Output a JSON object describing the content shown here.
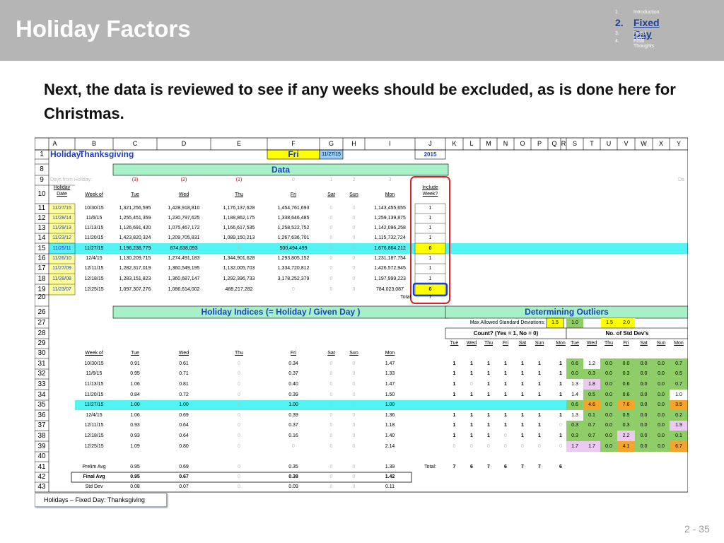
{
  "header": {
    "title": "Holiday Factors",
    "nav": [
      {
        "num": "1.",
        "label": "Introduction",
        "active": false
      },
      {
        "num": "2.",
        "label": "Fixed Day",
        "active": true
      },
      {
        "num": "3.",
        "label": "Fixed Date",
        "active": false
      },
      {
        "num": "4.",
        "label": "Final Thoughts",
        "active": false
      }
    ]
  },
  "subtitle": "Next, the data is reviewed to see if any weeks should be excluded, as is done here for Christmas.",
  "sheet": {
    "col_letters": [
      "A",
      "B",
      "C",
      "D",
      "E",
      "F",
      "G",
      "H",
      "I",
      "J",
      "K",
      "L",
      "M",
      "N",
      "O",
      "P",
      "Q",
      "R",
      "S",
      "T",
      "U",
      "V",
      "W",
      "X",
      "Y"
    ],
    "row1": {
      "rownum": "1",
      "holiday_label": "Holiday:",
      "holiday": "Thanksgiving",
      "day": "Fri",
      "date": "11/27/15",
      "year": "2015"
    },
    "row8": {
      "rownum": "8",
      "data_label": "Data"
    },
    "row9": {
      "rownum": "9",
      "label": "Days from Holiday:",
      "values": [
        "(3)",
        "(2)",
        "(1)",
        "0",
        "1",
        "2",
        "3"
      ],
      "trail": "Da"
    },
    "row10": {
      "rownum": "10",
      "holiday_date": "Holiday Date",
      "week_of": "Week of",
      "days": [
        "Tue",
        "Wed",
        "Thu",
        "Fri",
        "Sat",
        "Sun",
        "Mon"
      ],
      "include": "Include Week?"
    },
    "data_rows": [
      {
        "rownum": "11",
        "date": "11/27/15",
        "week": "10/30/15",
        "tue": "1,321,256,595",
        "wed": "1,428,918,810",
        "thu": "1,176,137,628",
        "fri": "1,454,761,693",
        "sat": "0",
        "sun": "0",
        "mon": "1,143,455,655",
        "inc": "1",
        "hl": false
      },
      {
        "rownum": "12",
        "date": "11/28/14",
        "week": "11/6/15",
        "tue": "1,255,451,359",
        "wed": "1,230,797,625",
        "thu": "1,188,862,175",
        "fri": "1,338,646,485",
        "sat": "0",
        "sun": "0",
        "mon": "1,259,139,875",
        "inc": "1",
        "hl": false
      },
      {
        "rownum": "13",
        "date": "11/29/13",
        "week": "11/13/15",
        "tue": "1,126,691,420",
        "wed": "1,075,467,172",
        "thu": "1,166,617,535",
        "fri": "1,258,522,752",
        "sat": "0",
        "sun": "0",
        "mon": "1,142,096,258",
        "inc": "1",
        "hl": false
      },
      {
        "rownum": "14",
        "date": "11/23/12",
        "week": "11/20/15",
        "tue": "1,423,820,324",
        "wed": "1,209,705,831",
        "thu": "1,089,150,213",
        "fri": "1,267,636,701",
        "sat": "0",
        "sun": "0",
        "mon": "1,115,732,724",
        "inc": "1",
        "hl": false
      },
      {
        "rownum": "15",
        "date": "11/25/11",
        "week": "11/27/15",
        "tue": "1,196,238,779",
        "wed": "874,638,093",
        "thu": "0",
        "fri": "500,494,499",
        "sat": "0",
        "sun": "0",
        "mon": "1,676,864,212",
        "inc": "0",
        "hl": true
      },
      {
        "rownum": "16",
        "date": "11/26/10",
        "week": "12/4/15",
        "tue": "1,130,209,715",
        "wed": "1,274,491,183",
        "thu": "1,344,901,628",
        "fri": "1,293,805,152",
        "sat": "0",
        "sun": "0",
        "mon": "1,231,187,754",
        "inc": "1",
        "hl": false
      },
      {
        "rownum": "17",
        "date": "11/27/09",
        "week": "12/11/15",
        "tue": "1,282,317,019",
        "wed": "1,360,549,195",
        "thu": "1,132,005,703",
        "fri": "1,334,720,812",
        "sat": "0",
        "sun": "0",
        "mon": "1,426,572,945",
        "inc": "1",
        "hl": false
      },
      {
        "rownum": "18",
        "date": "11/28/08",
        "week": "12/18/15",
        "tue": "1,283,151,823",
        "wed": "1,360,687,147",
        "thu": "1,292,396,733",
        "fri": "3,178,252,379",
        "sat": "0",
        "sun": "0",
        "mon": "1,197,999,223",
        "inc": "1",
        "hl": false
      },
      {
        "rownum": "19",
        "date": "11/23/07",
        "week": "12/25/15",
        "tue": "1,097,307,276",
        "wed": "1,086,614,002",
        "thu": "488,217,282",
        "fri": "0",
        "sat": "0",
        "sun": "0",
        "mon": "784,023,087",
        "inc": "0",
        "hl": false
      }
    ],
    "row20": {
      "rownum": "20",
      "total_label": "Total:",
      "total": "7"
    },
    "row26": {
      "rownum": "26",
      "indices_label": "Holiday Indices  (= Holiday / Given Day )",
      "outliers_label": "Determining Outliers"
    },
    "row27": {
      "rownum": "27",
      "max_label": "Max Allowed Standard Deviations:",
      "v1": "1.5",
      "v2": "1.0",
      "v3": "1.5",
      "v4": "2.0"
    },
    "row28": {
      "rownum": "28",
      "count_label": "Count?  (Yes = 1, No = 0)",
      "std_label": "No. of Std Dev's"
    },
    "row29": {
      "rownum": "29",
      "days_a": [
        "Tue",
        "Wed",
        "Thu",
        "Fri",
        "Sat",
        "Sun",
        "Mon"
      ],
      "days_b": [
        "Tue",
        "Wed",
        "Thu",
        "Fri",
        "Sat",
        "Sun",
        "Mon"
      ]
    },
    "row30": {
      "rownum": "30",
      "week_of": "Week of",
      "days": [
        "Tue",
        "Wed",
        "Thu",
        "Fri",
        "Sat",
        "Sun",
        "Mon"
      ]
    },
    "index_rows": [
      {
        "rownum": "31",
        "week": "10/30/15",
        "tue": "0.91",
        "wed": "0.61",
        "thu": "0",
        "fri": "0.34",
        "sat": "0",
        "sun": "0",
        "mon": "1.47",
        "cnt": [
          "1",
          "1",
          "1",
          "1",
          "1",
          "1",
          "1"
        ],
        "sd": [
          "0.6",
          "1.2",
          "0.0",
          "0.0",
          "0.0",
          "0.0",
          "0.7"
        ],
        "hl": false
      },
      {
        "rownum": "32",
        "week": "11/6/15",
        "tue": "0.95",
        "wed": "0.71",
        "thu": "0",
        "fri": "0.37",
        "sat": "0",
        "sun": "0",
        "mon": "1.33",
        "cnt": [
          "1",
          "1",
          "1",
          "1",
          "1",
          "1",
          "1"
        ],
        "sd": [
          "0.0",
          "0.3",
          "0.0",
          "0.3",
          "0.0",
          "0.0",
          "0.5"
        ],
        "hl": false
      },
      {
        "rownum": "33",
        "week": "11/13/15",
        "tue": "1.06",
        "wed": "0.81",
        "thu": "0",
        "fri": "0.40",
        "sat": "0",
        "sun": "0",
        "mon": "1.47",
        "cnt": [
          "1",
          "0",
          "1",
          "1",
          "1",
          "1",
          "1"
        ],
        "sd": [
          "1.3",
          "1.8",
          "0.0",
          "0.6",
          "0.0",
          "0.0",
          "0.7"
        ],
        "hl": false
      },
      {
        "rownum": "34",
        "week": "11/20/15",
        "tue": "0.84",
        "wed": "0.72",
        "thu": "0",
        "fri": "0.39",
        "sat": "0",
        "sun": "0",
        "mon": "1.50",
        "cnt": [
          "1",
          "1",
          "1",
          "1",
          "1",
          "1",
          "1"
        ],
        "sd": [
          "1.4",
          "0.5",
          "0.0",
          "0.6",
          "0.0",
          "0.0",
          "1.0"
        ],
        "hl": false
      },
      {
        "rownum": "35",
        "week": "11/27/15",
        "tue": "1.00",
        "wed": "1.00",
        "thu": "0",
        "fri": "1.00",
        "sat": "0",
        "sun": "0",
        "mon": "1.00",
        "cnt": [
          "",
          "",
          "",
          "",
          "",
          "",
          ""
        ],
        "sd": [
          "0.6",
          "4.6",
          "0.0",
          "7.6",
          "0.0",
          "0.0",
          "3.5"
        ],
        "hl": true
      },
      {
        "rownum": "36",
        "week": "12/4/15",
        "tue": "1.06",
        "wed": "0.69",
        "thu": "0",
        "fri": "0.39",
        "sat": "0",
        "sun": "0",
        "mon": "1.36",
        "cnt": [
          "1",
          "1",
          "1",
          "1",
          "1",
          "1",
          "1"
        ],
        "sd": [
          "1.3",
          "0.1",
          "0.0",
          "0.5",
          "0.0",
          "0.0",
          "0.2"
        ],
        "hl": false
      },
      {
        "rownum": "37",
        "week": "12/11/15",
        "tue": "0.93",
        "wed": "0.64",
        "thu": "0",
        "fri": "0.37",
        "sat": "0",
        "sun": "0",
        "mon": "1.18",
        "cnt": [
          "1",
          "1",
          "1",
          "1",
          "1",
          "1",
          "0"
        ],
        "sd": [
          "0.3",
          "0.7",
          "0.0",
          "0.3",
          "0.0",
          "0.0",
          "1.9"
        ],
        "hl": false
      },
      {
        "rownum": "38",
        "week": "12/18/15",
        "tue": "0.93",
        "wed": "0.64",
        "thu": "0",
        "fri": "0.16",
        "sat": "0",
        "sun": "0",
        "mon": "1.40",
        "cnt": [
          "1",
          "1",
          "1",
          "0",
          "1",
          "1",
          "1"
        ],
        "sd": [
          "0.3",
          "0.7",
          "0.0",
          "2.2",
          "0.0",
          "0.0",
          "0.1"
        ],
        "hl": false
      },
      {
        "rownum": "39",
        "week": "12/25/15",
        "tue": "1.09",
        "wed": "0.80",
        "thu": "0",
        "fri": "0",
        "sat": "0",
        "sun": "0",
        "mon": "2.14",
        "cnt": [
          "0",
          "0",
          "0",
          "0",
          "0",
          "0",
          "0"
        ],
        "sd": [
          "1.7",
          "1.7",
          "0.0",
          "4.1",
          "0.0",
          "0.0",
          "6.7"
        ],
        "hl": false
      }
    ],
    "row40": {
      "rownum": "40"
    },
    "row41": {
      "rownum": "41",
      "label": "Prelim Avg",
      "tue": "0.95",
      "wed": "0.69",
      "thu": "0",
      "fri": "0.35",
      "sat": "0",
      "sun": "0",
      "mon": "1.39",
      "total_label": "Total:",
      "totals": [
        "7",
        "6",
        "7",
        "6",
        "7",
        "7",
        "6"
      ]
    },
    "row42": {
      "rownum": "42",
      "label": "Final Avg",
      "tue": "0.95",
      "wed": "0.67",
      "thu": "0",
      "fri": "0.38",
      "sat": "0",
      "sun": "0",
      "mon": "1.42"
    },
    "row43": {
      "rownum": "43",
      "label": "Std Dev",
      "tue": "0.08",
      "wed": "0.07",
      "thu": "0",
      "fri": "0.09",
      "sat": "0",
      "sun": "0",
      "mon": "0.11"
    }
  },
  "footer": {
    "tab_label": "Holidays – Fixed Day:  Thanksgiving",
    "page_number": "2 -  35"
  },
  "colors": {
    "header_bg": "#b5b5b5",
    "nav_active": "#1f3f8f",
    "data_header_green": "#a8f0c8",
    "highlight_cyan": "#54f3f3",
    "date_yellow": "#ffff99",
    "fri_yellow": "#ffff00",
    "date_blue": "#99ccff",
    "sd_high": "#f4a62c",
    "sd_mid": "#e9e9b0",
    "sd_purple": "#ebc9f1",
    "sd_green": "#8fcd68",
    "red_outline": "#e02020",
    "blue_outline": "#1a3fd0"
  }
}
